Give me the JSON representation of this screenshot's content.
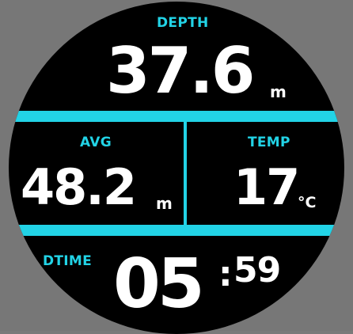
{
  "depth": {
    "label": "DEPTH",
    "value": "37.6",
    "unit": "m"
  },
  "avg": {
    "label": "AVG",
    "value": "48.2",
    "unit": "m"
  },
  "temp": {
    "label": "TEMP",
    "value": "17",
    "unit": "°C"
  },
  "dtime": {
    "label": "DTIME",
    "minutes": "05",
    "separator": ":",
    "seconds": "59"
  },
  "colors": {
    "accent": "#22d3e6",
    "text": "#ffffff",
    "background": "#000000"
  }
}
